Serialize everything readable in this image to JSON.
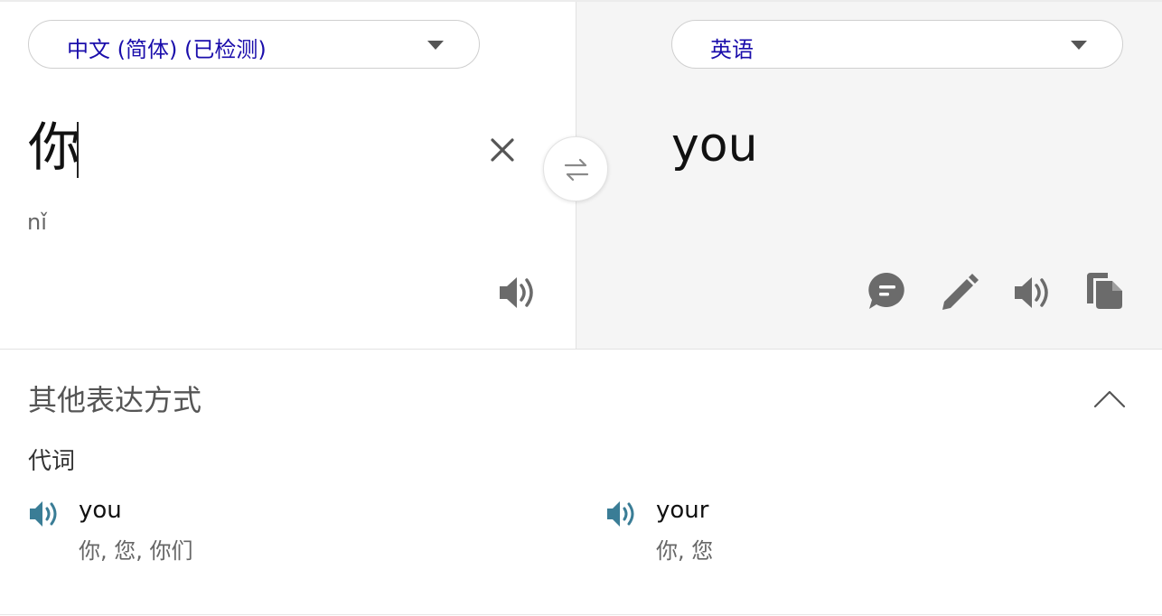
{
  "source": {
    "language_label": "中文 (简体) (已检测)",
    "text": "你",
    "transliteration": "nǐ"
  },
  "target": {
    "language_label": "英语",
    "text": "you"
  },
  "icons": {
    "source_dropdown": "chevron-down-icon",
    "target_dropdown": "chevron-down-icon",
    "clear": "close-icon",
    "swap": "swap-arrows-icon",
    "source_listen": "speaker-icon",
    "feedback": "chat-bubble-icon",
    "edit": "pencil-icon",
    "target_listen": "speaker-icon",
    "copy": "copy-icon",
    "collapse": "chevron-up-icon"
  },
  "alternatives": {
    "title": "其他表达方式",
    "part_of_speech": "代词",
    "items": [
      {
        "word": "you",
        "back_translations": "你, 您, 你们"
      },
      {
        "word": "your",
        "back_translations": "你, 您"
      }
    ]
  },
  "colors": {
    "language_label": "#1a0dab",
    "icon_gray": "#6b6b6b",
    "alt_speaker": "#3a7d96",
    "target_pane_bg": "#f5f5f5"
  }
}
